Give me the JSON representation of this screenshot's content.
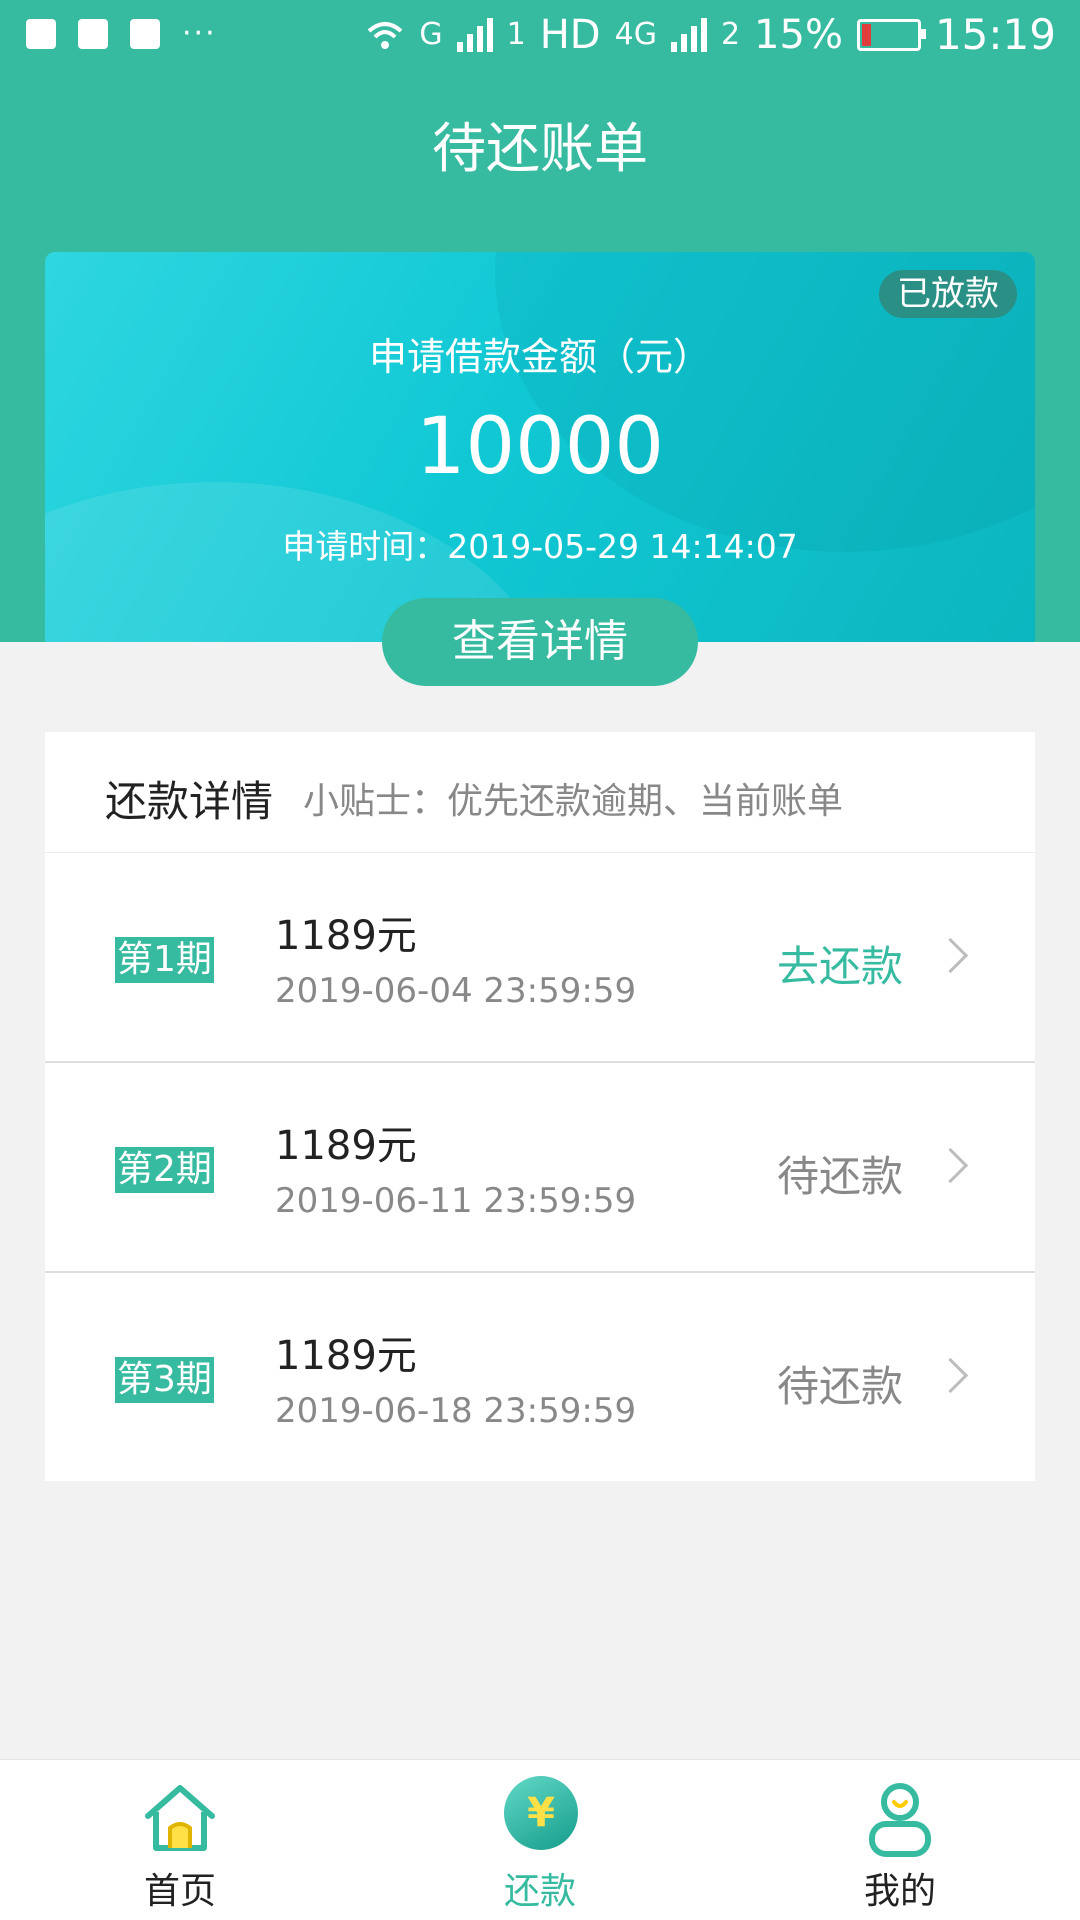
{
  "status_bar": {
    "network_g": "G",
    "sim1": "1",
    "hd": "HD",
    "net_4g": "4G",
    "sim2": "2",
    "battery_pct": "15%",
    "time": "15:19"
  },
  "header": {
    "title": "待还账单"
  },
  "loan_card": {
    "badge": "已放款",
    "amount_label": "申请借款金额（元）",
    "amount": "10000",
    "apply_time": "申请时间：2019-05-29 14:14:07",
    "detail_button": "查看详情"
  },
  "repay": {
    "title": "还款详情",
    "tip": "小贴士：优先还款逾期、当前账单",
    "items": [
      {
        "period": "第1期",
        "amount": "1189元",
        "due": "2019-06-04 23:59:59",
        "action": "去还款"
      },
      {
        "period": "第2期",
        "amount": "1189元",
        "due": "2019-06-11 23:59:59",
        "action": "待还款"
      },
      {
        "period": "第3期",
        "amount": "1189元",
        "due": "2019-06-18 23:59:59",
        "action": "待还款"
      }
    ]
  },
  "tabbar": {
    "home": "首页",
    "repay": "还款",
    "repay_icon": "¥",
    "mine": "我的"
  },
  "colors": {
    "brand": "#36bba0",
    "badge_bg": "#2a8f84",
    "battery_low": "#e23d3d"
  }
}
